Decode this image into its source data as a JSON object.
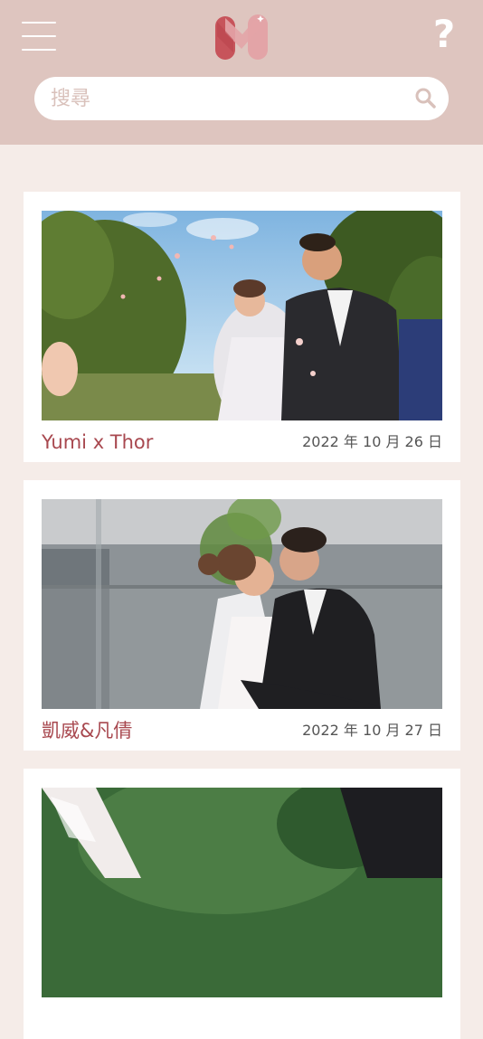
{
  "header": {
    "menu_icon": "hamburger-menu-icon",
    "logo_icon": "app-logo-icon",
    "help_label": "?"
  },
  "search": {
    "placeholder": "搜尋",
    "icon": "search-icon"
  },
  "colors": {
    "header_bg": "#dec5bf",
    "page_bg": "#f5ece8",
    "title_color": "#a8484f",
    "logo_primary": "#c7545b",
    "logo_secondary": "#e3a4a7"
  },
  "albums": [
    {
      "title": "Yumi x Thor",
      "date": "2022 年 10 月 26 日"
    },
    {
      "title": "凱威&凡倩",
      "date": "2022 年 10 月 27 日"
    },
    {
      "title": "",
      "date": ""
    }
  ]
}
